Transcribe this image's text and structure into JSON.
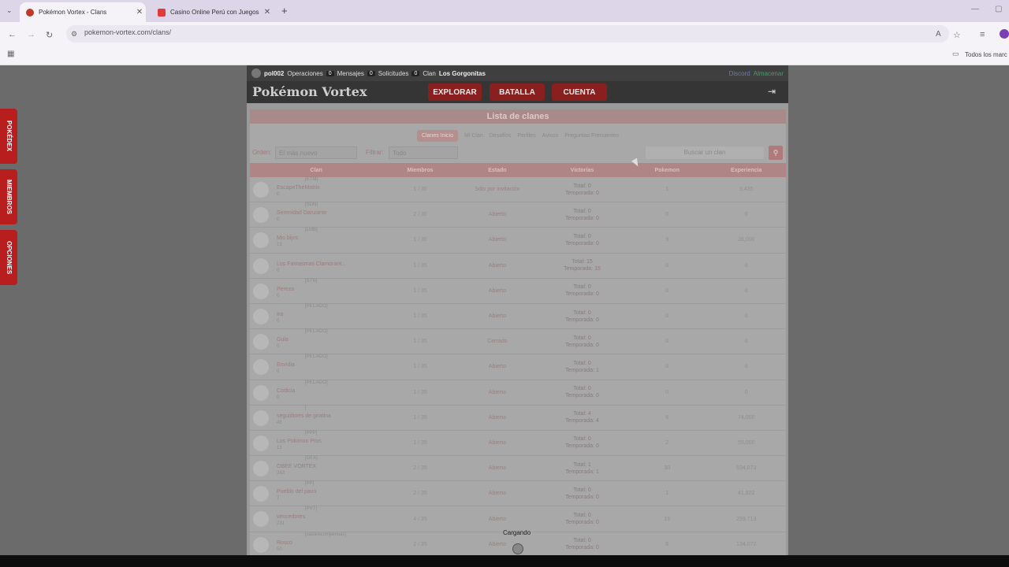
{
  "browser": {
    "tabs": [
      {
        "title": "Pokémon Vortex - Clans",
        "color": "#c0392b"
      },
      {
        "title": "Casino Online Perú con Juegos",
        "color": "#e03a3a"
      }
    ],
    "url": "pokemon-vortex.com/clans/",
    "bookmarks_label": "Todos los marc"
  },
  "site": {
    "topbar": {
      "user": "pol002",
      "ops_label": "Operaciones",
      "ops_count": "0",
      "msgs_label": "Mensajes",
      "msgs_count": "0",
      "reqs_label": "Solicitudes",
      "reqs_count": "0",
      "clan_label": "Clan",
      "clan_name": "Los Gorgonitas",
      "discord": "Discord",
      "store": "Almacenar"
    },
    "logo": "Pokémon Vortex",
    "nav": [
      "EXPLORAR",
      "BATALLA",
      "CUENTA"
    ],
    "banner": "Lista de clanes",
    "subtabs": [
      "Clanes Inicio",
      "Mi Clan",
      "Desafíos",
      "Perfiles",
      "Avisos",
      "Preguntas Frecuentes"
    ],
    "filters": {
      "order_label": "Orden:",
      "order_value": "El más nuevo",
      "filter_label": "Filtrar:",
      "filter_value": "Todo",
      "search_placeholder": "Buscar un clan"
    },
    "columns": [
      "Clan",
      "Miembros",
      "Estado",
      "Victorias",
      "Pokemon",
      "Experiencia"
    ],
    "rows": [
      {
        "name": "EscapeTheMatrix",
        "tag": "[ETM]",
        "level": "0",
        "members": "1 / 35",
        "status": "Sólo por invitación",
        "total": "Total: 0",
        "season": "Temporada: 0",
        "pokemon": "1",
        "exp": "6,435"
      },
      {
        "name": "Serenidad Danzante",
        "tag": "[SDN]",
        "level": "0",
        "members": "2 / 35",
        "status": "Abierto",
        "total": "Total: 0",
        "season": "Temporada: 0",
        "pokemon": "0",
        "exp": "0"
      },
      {
        "name": "Mis bijos",
        "tag": "[LMB]",
        "level": "13",
        "members": "1 / 35",
        "status": "Abierto",
        "total": "Total: 0",
        "season": "Temporada: 0",
        "pokemon": "9",
        "exp": "26,000"
      },
      {
        "name": "Los Fantasmas Clamorant...",
        "tag": "",
        "level": "0",
        "members": "1 / 35",
        "status": "Abierto",
        "total": "Total: 15",
        "season": "Temporada: 15",
        "pokemon": "0",
        "exp": "0"
      },
      {
        "name": "Pereza",
        "tag": "[STN]",
        "level": "0",
        "members": "1 / 35",
        "status": "Abierto",
        "total": "Total: 0",
        "season": "Temporada: 0",
        "pokemon": "0",
        "exp": "0"
      },
      {
        "name": "Ira",
        "tag": "[PECADO]",
        "level": "0",
        "members": "1 / 35",
        "status": "Abierto",
        "total": "Total: 0",
        "season": "Temporada: 0",
        "pokemon": "0",
        "exp": "0"
      },
      {
        "name": "Gula",
        "tag": "[PECADO]",
        "level": "0",
        "members": "1 / 35",
        "status": "Cerrado",
        "total": "Total: 0",
        "season": "Temporada: 0",
        "pokemon": "0",
        "exp": "0"
      },
      {
        "name": "Envidia",
        "tag": "[PECADO]",
        "level": "0",
        "members": "1 / 35",
        "status": "Abierto",
        "total": "Total: 0",
        "season": "Temporada: 1",
        "pokemon": "0",
        "exp": "0"
      },
      {
        "name": "Codicia",
        "tag": "[PECADO]",
        "level": "0",
        "members": "1 / 35",
        "status": "Abierto",
        "total": "Total: 0",
        "season": "Temporada: 0",
        "pokemon": "0",
        "exp": "0"
      },
      {
        "name": "seguidores de giratina",
        "tag": "[",
        "level": "45",
        "members": "1 / 35",
        "status": "Abierto",
        "total": "Total: 4",
        "season": "Temporada: 4",
        "pokemon": "6",
        "exp": "74,000"
      },
      {
        "name": "Los Pokimon Pros",
        "tag": "[PPP]",
        "level": "13",
        "members": "1 / 35",
        "status": "Abierto",
        "total": "Total: 0",
        "season": "Temporada: 0",
        "pokemon": "2",
        "exp": "55,000"
      },
      {
        "name": "OBEE VORTEX",
        "tag": "[OFX]",
        "level": "263",
        "members": "2 / 35",
        "status": "Abierto",
        "total": "Total: 1",
        "season": "Temporada: 1",
        "pokemon": "30",
        "exp": "634,073"
      },
      {
        "name": "Pueblo del pavo",
        "tag": "[PP]",
        "level": "7",
        "members": "2 / 35",
        "status": "Abierto",
        "total": "Total: 0",
        "season": "Temporada: 0",
        "pokemon": "1",
        "exp": "41,822"
      },
      {
        "name": "vencedores",
        "tag": "[PVT]",
        "level": "231",
        "members": "4 / 35",
        "status": "Abierto",
        "total": "Total: 0",
        "season": "Temporada: 0",
        "pokemon": "19",
        "exp": "259,713"
      },
      {
        "name": "Rosco",
        "tag": "[cazarecompensas]",
        "level": "50",
        "members": "2 / 35",
        "status": "Abierto",
        "total": "Total: 0",
        "season": "Temporada: 0",
        "pokemon": "6",
        "exp": "134,072"
      }
    ],
    "side_tabs": [
      "POKÉDEX",
      "MIEMBROS",
      "OPCIONES"
    ],
    "loading": "Cargando"
  }
}
